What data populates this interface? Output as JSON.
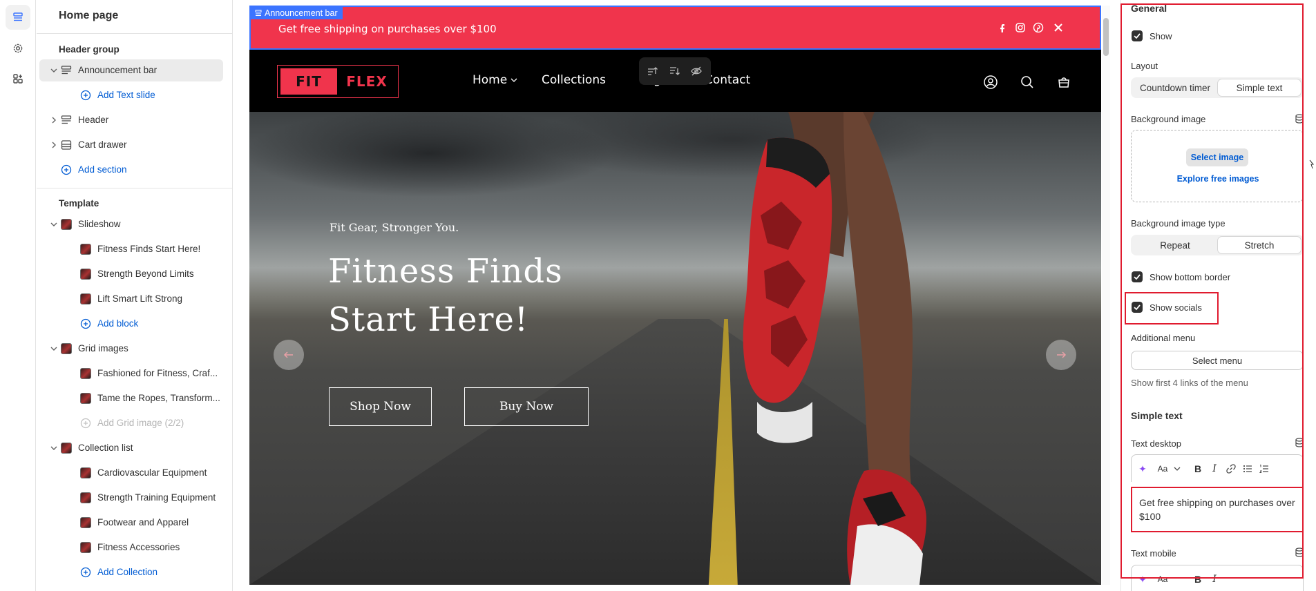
{
  "left_panel": {
    "title": "Home page",
    "header_group_label": "Header group",
    "header_group_items": [
      {
        "label": "Announcement bar"
      },
      {
        "label": "Add Text slide"
      },
      {
        "label": "Header"
      },
      {
        "label": "Cart drawer"
      },
      {
        "label": "Add section"
      }
    ],
    "template_label": "Template",
    "template_items": [
      {
        "label": "Slideshow"
      },
      {
        "label": "Fitness Finds Start Here!"
      },
      {
        "label": "Strength Beyond Limits"
      },
      {
        "label": "Lift Smart Lift Strong"
      },
      {
        "label": "Add block"
      },
      {
        "label": "Grid images"
      },
      {
        "label": "Fashioned for Fitness, Craf..."
      },
      {
        "label": "Tame the Ropes, Transform..."
      },
      {
        "label": "Add Grid image (2/2)"
      },
      {
        "label": "Collection list"
      },
      {
        "label": "Cardiovascular Equipment"
      },
      {
        "label": "Strength Training Equipment"
      },
      {
        "label": "Footwear and Apparel"
      },
      {
        "label": "Fitness Accessories"
      },
      {
        "label": "Add Collection"
      }
    ]
  },
  "preview": {
    "section_tag": "Announcement bar",
    "announcement_text": "Get free shipping on purchases over $100",
    "logo_left": "FIT",
    "logo_right": "FLEX",
    "nav": [
      "Home",
      "Collections",
      "Pages",
      "Contact"
    ],
    "hero_subtitle": "Fit Gear, Stronger You.",
    "hero_title": "Fitness Finds Start Here!",
    "buttons": [
      "Shop Now",
      "Buy Now"
    ],
    "colors": {
      "announcement_bg": "#f0344c",
      "selection": "#3b74ff"
    }
  },
  "settings": {
    "general_heading": "General",
    "show_label": "Show",
    "show_checked": true,
    "layout_label": "Layout",
    "layout_options": [
      "Countdown timer",
      "Simple text"
    ],
    "layout_selected": "Simple text",
    "bg_image_label": "Background image",
    "select_image": "Select image",
    "explore_images": "Explore free images",
    "bg_type_label": "Background image type",
    "bg_type_options": [
      "Repeat",
      "Stretch"
    ],
    "bg_type_selected": "Stretch",
    "show_bottom_border": "Show bottom border",
    "show_socials": "Show socials",
    "additional_menu_label": "Additional menu",
    "select_menu": "Select menu",
    "menu_help": "Show first 4 links of the menu",
    "simple_text_heading": "Simple text",
    "text_desktop_label": "Text desktop",
    "text_desktop_value": "Get free shipping on purchases over $100",
    "text_mobile_label": "Text mobile",
    "rte_font_label": "Aa"
  }
}
